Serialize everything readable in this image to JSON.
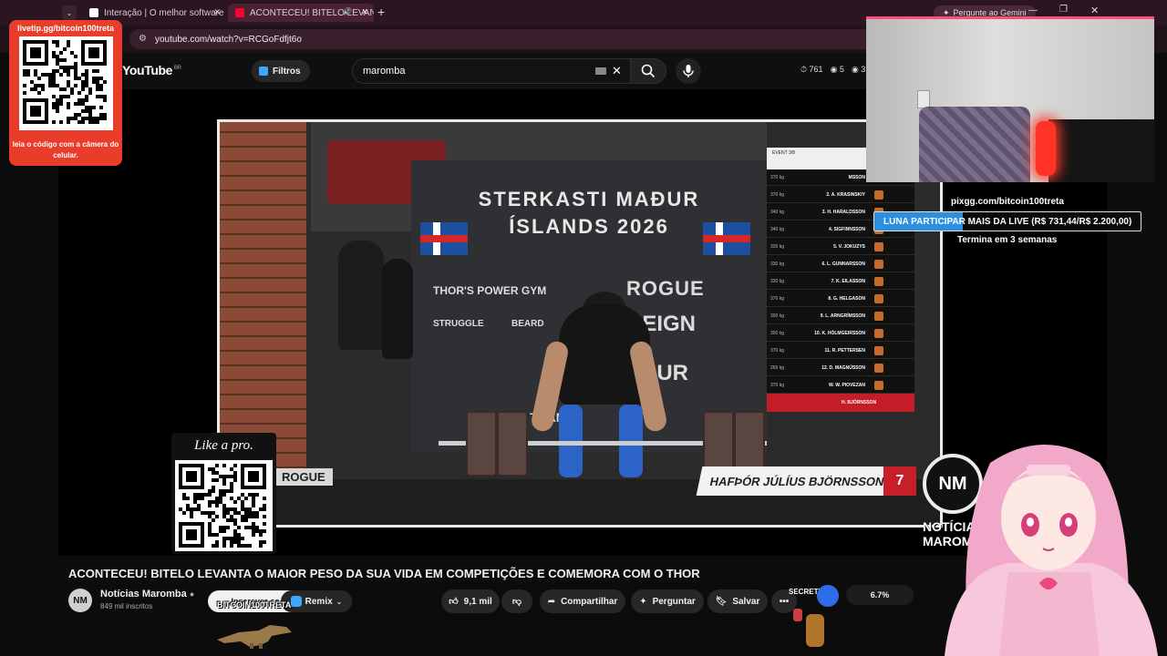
{
  "browser": {
    "tabs": [
      {
        "title": "Interação | O melhor software p"
      },
      {
        "title": "ACONTECEU! BITELO LEVAN"
      }
    ],
    "url": "youtube.com/watch?v=RCGoFdfjt6o",
    "gemini": "Pergunte ao Gemini"
  },
  "youtube": {
    "logo": "YouTube",
    "region": "BR",
    "filters_label": "Filtros",
    "search_query": "maromba",
    "viewers": "761",
    "stat2": "5",
    "stat3": "3"
  },
  "overlay": {
    "livetip_url": "livetip.gg/bitcoin100treta",
    "livetip_caption": "leia o código com a câmera do celular.",
    "like_a_pro": "Like a pro.",
    "pix_url": "pixgg.com/bitcoin100treta",
    "goal_text": "LUNA PARTICIPAR MAIS DA LIVE (R$ 731,44/R$ 2.200,00)",
    "goal_progress": 0.3325,
    "goal_ends": "Termina em 3 semanas",
    "btc_overlay": "BITCOIN100TRETA",
    "secret": "SECRETKING",
    "percent": "6.7%"
  },
  "video_scene": {
    "banner_title_1": "STERKASTI MAÐUR",
    "banner_title_2": "ÍSLANDS 2026",
    "sponsor_1": "THOR'S POWER GYM",
    "sponsor_2": "ROGUE",
    "sponsor_3": "REIGN",
    "sponsor_4": "VDUR",
    "sponsor_5": "STRUGGLE",
    "sponsor_6": "BEARD",
    "sponsor_7": "TRANSF",
    "floor_brand": "ROGUE",
    "athlete_name": "HAFÞÓR JÚLÍUS BJÖRNSSON",
    "athlete_number": "7",
    "leaderboard_header": "EVENT 3/8",
    "leaderboard": [
      {
        "weight": "370 kg",
        "rank": "",
        "name": "MSSON"
      },
      {
        "weight": "370 kg",
        "rank": "2.",
        "name": "A. KRASINSKIY"
      },
      {
        "weight": "340 kg",
        "rank": "3.",
        "name": "H. HARALDSSON"
      },
      {
        "weight": "340 kg",
        "rank": "4.",
        "name": "SIGFINNSSON"
      },
      {
        "weight": "335 kg",
        "rank": "5.",
        "name": "V. JOKUZYS"
      },
      {
        "weight": "330 kg",
        "rank": "6.",
        "name": "L. GUNNARSSON"
      },
      {
        "weight": "330 kg",
        "rank": "7.",
        "name": "K. EILASSON"
      },
      {
        "weight": "370 kg",
        "rank": "8.",
        "name": "G. HELGASON"
      },
      {
        "weight": "300 kg",
        "rank": "9.",
        "name": "L. ARNGRÍMSSON"
      },
      {
        "weight": "300 kg",
        "rank": "10.",
        "name": "K. HÓLMGEIRSSON"
      },
      {
        "weight": "370 kg",
        "rank": "11.",
        "name": "R. PETTERSEN"
      },
      {
        "weight": "265 kg",
        "rank": "12.",
        "name": "D. MAGNÚSSON"
      },
      {
        "weight": "370 kg",
        "rank": "W.",
        "name": "W. PIOVEZAN"
      }
    ],
    "leaderboard_current": "H. BJÖRNSSON"
  },
  "video": {
    "title": "ACONTECEU! BITELO LEVANTA O MAIOR PESO DA SUA VIDA EM COMPETIÇÕES E COMEMORA COM O THOR",
    "channel_name": "Notícias Maromba",
    "channel_initials": "NM",
    "subscribers": "849 mil inscritos",
    "subscribe_label": "Inscrever-se",
    "remix_label": "Remix",
    "likes": "9,1 mil",
    "share_label": "Compartilhar",
    "ask_label": "Perguntar",
    "save_label": "Salvar",
    "logo_line1": "NOTÍCIAS",
    "logo_line2": "MAROMBA"
  }
}
